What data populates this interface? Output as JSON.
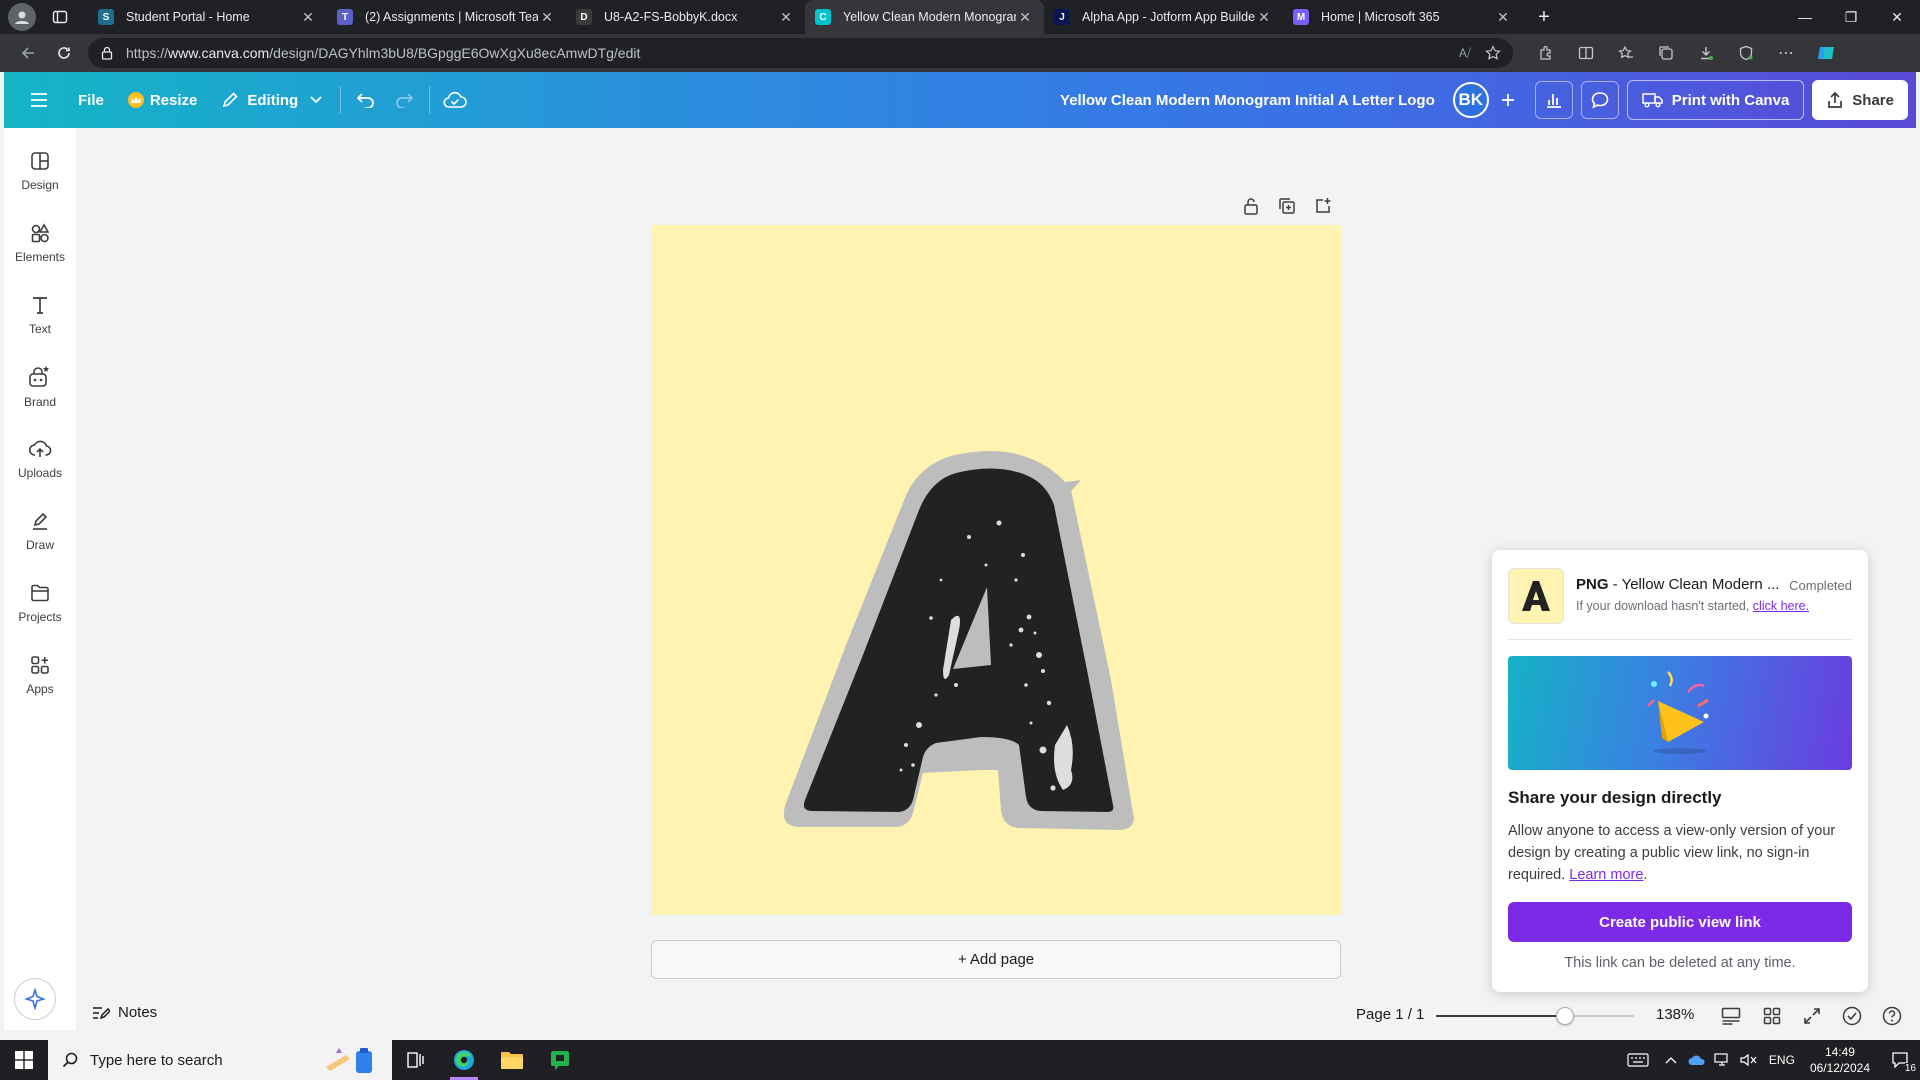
{
  "browser": {
    "tabs": [
      {
        "title": "Student Portal - Home",
        "fav_color": "#1d6f8f",
        "fav_glyph": "S"
      },
      {
        "title": "(2) Assignments | Microsoft Teams",
        "fav_color": "#5b5fc7",
        "fav_glyph": "T"
      },
      {
        "title": "U8-A2-FS-BobbyK.docx",
        "fav_color": "#3b3b3b",
        "fav_glyph": "D"
      },
      {
        "title": "Yellow Clean Modern Monogram Initial A Letter Logo",
        "fav_color": "#00c4cc",
        "fav_glyph": "C"
      },
      {
        "title": "Alpha App - Jotform App Builder",
        "fav_color": "#0a1551",
        "fav_glyph": "J"
      },
      {
        "title": "Home | Microsoft 365",
        "fav_color": "#7b5cff",
        "fav_glyph": "M"
      }
    ],
    "active_tab": 3,
    "url_prefix": "https://",
    "url_host": "www.canva.com",
    "url_path": "/design/DAGYhlm3bU8/BGpggE6OwXgXu8ecAmwDTg/edit"
  },
  "header": {
    "file_label": "File",
    "resize_label": "Resize",
    "editing_label": "Editing",
    "doc_title": "Yellow Clean Modern Monogram Initial A Letter Logo",
    "avatar_initials": "BK",
    "print_label": "Print with Canva",
    "share_label": "Share"
  },
  "sidebar": {
    "items": [
      {
        "label": "Design",
        "icon": "design-icon"
      },
      {
        "label": "Elements",
        "icon": "elements-icon"
      },
      {
        "label": "Text",
        "icon": "text-icon"
      },
      {
        "label": "Brand",
        "icon": "brand-icon"
      },
      {
        "label": "Uploads",
        "icon": "uploads-icon"
      },
      {
        "label": "Draw",
        "icon": "draw-icon"
      },
      {
        "label": "Projects",
        "icon": "projects-icon"
      },
      {
        "label": "Apps",
        "icon": "apps-icon"
      }
    ]
  },
  "canvas": {
    "background_color": "#fef3b0",
    "letter": "A",
    "add_page_label": "+ Add page"
  },
  "download_popup": {
    "format": "PNG",
    "file_name": " - Yellow Clean Modern ...",
    "status": "Completed",
    "hint_text": "If your download hasn't started, ",
    "hint_link": "click here.",
    "share_heading": "Share your design directly",
    "share_body": "Allow anyone to access a view-only version of your design by creating a public view link, no sign-in required. ",
    "learn_more": "Learn more",
    "cta_label": "Create public view link",
    "footer_note": "This link can be deleted at any time."
  },
  "bottom_bar": {
    "notes_label": "Notes",
    "page_info": "Page 1 / 1",
    "zoom_label": "138%",
    "zoom_fraction": 0.65
  },
  "taskbar": {
    "search_placeholder": "Type here to search",
    "language": "ENG",
    "time": "14:49",
    "date": "06/12/2024",
    "notification_count": "16"
  }
}
